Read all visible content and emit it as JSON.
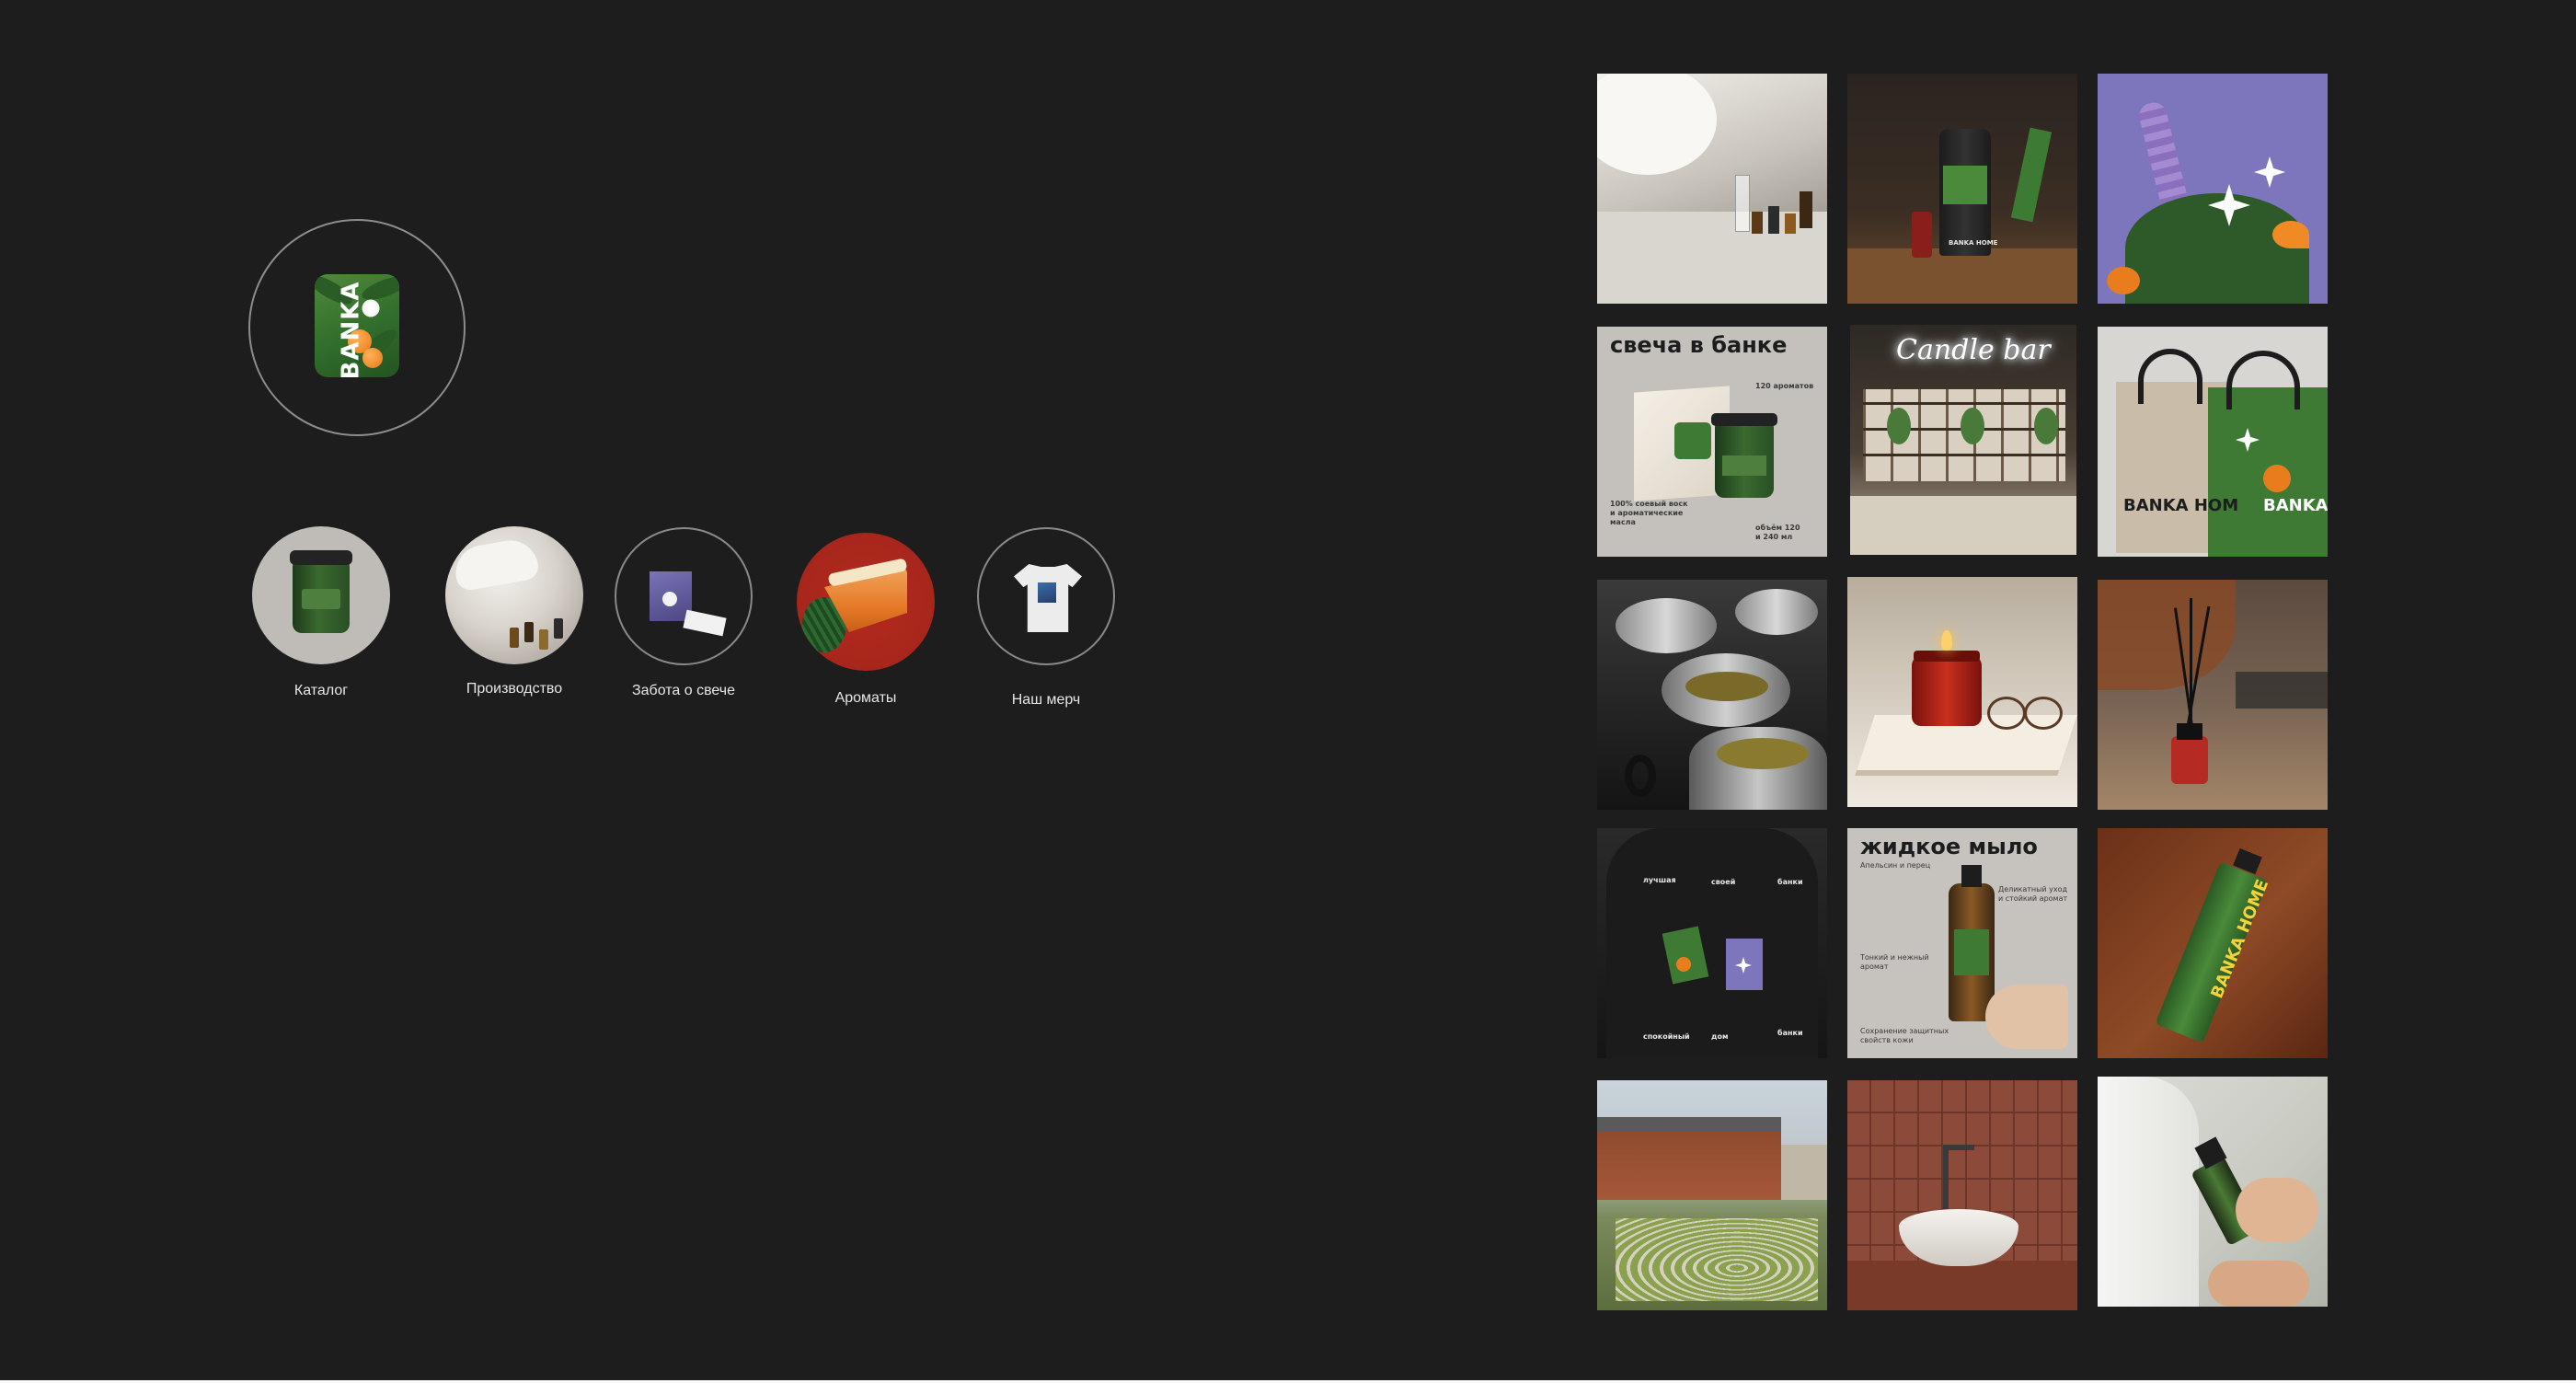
{
  "highlights": [
    {
      "label": "Каталог"
    },
    {
      "label": "Производство"
    },
    {
      "label": "Забота о свече"
    },
    {
      "label": "Ароматы"
    },
    {
      "label": "Наш мерч"
    }
  ],
  "posts": {
    "lab": {},
    "soap_bottle": {
      "brand": "BANKA HOME"
    },
    "flowers": {},
    "candle_card": {
      "title": "свеча в банке",
      "note_top": "120 ароматов",
      "note_left": "100% соевый воск\nи ароматические\nмасла",
      "note_right": "объём 120\nи 240 мл"
    },
    "candle_bar": {
      "neon": "Candle bar"
    },
    "bags": {
      "brand_left": "BANKA HOM",
      "brand_right": "BANKA"
    },
    "wax_pitchers": {},
    "candle_book": {},
    "diffuser": {},
    "tshirt_back": {
      "word1": "лучшая",
      "word2": "своей",
      "word3": "банки",
      "word4": "спокойный",
      "word5": "дом",
      "word6": "банки"
    },
    "soap_card": {
      "title": "жидкое мыло",
      "note1": "Апельсин и перец",
      "note2": "Деликатный уход\nи стойкий аромат",
      "note3": "Тонкий и нежный\nаромат",
      "note4": "Сохранение защитных\nсвойств кожи"
    },
    "cream_tube": {
      "brand": "BANKA HOME"
    },
    "courtyard": {},
    "sink": {},
    "spray": {}
  },
  "colors": {
    "background": "#1d1d1d",
    "brand_green": "#3f7a34",
    "accent_orange": "#e97c1c"
  }
}
